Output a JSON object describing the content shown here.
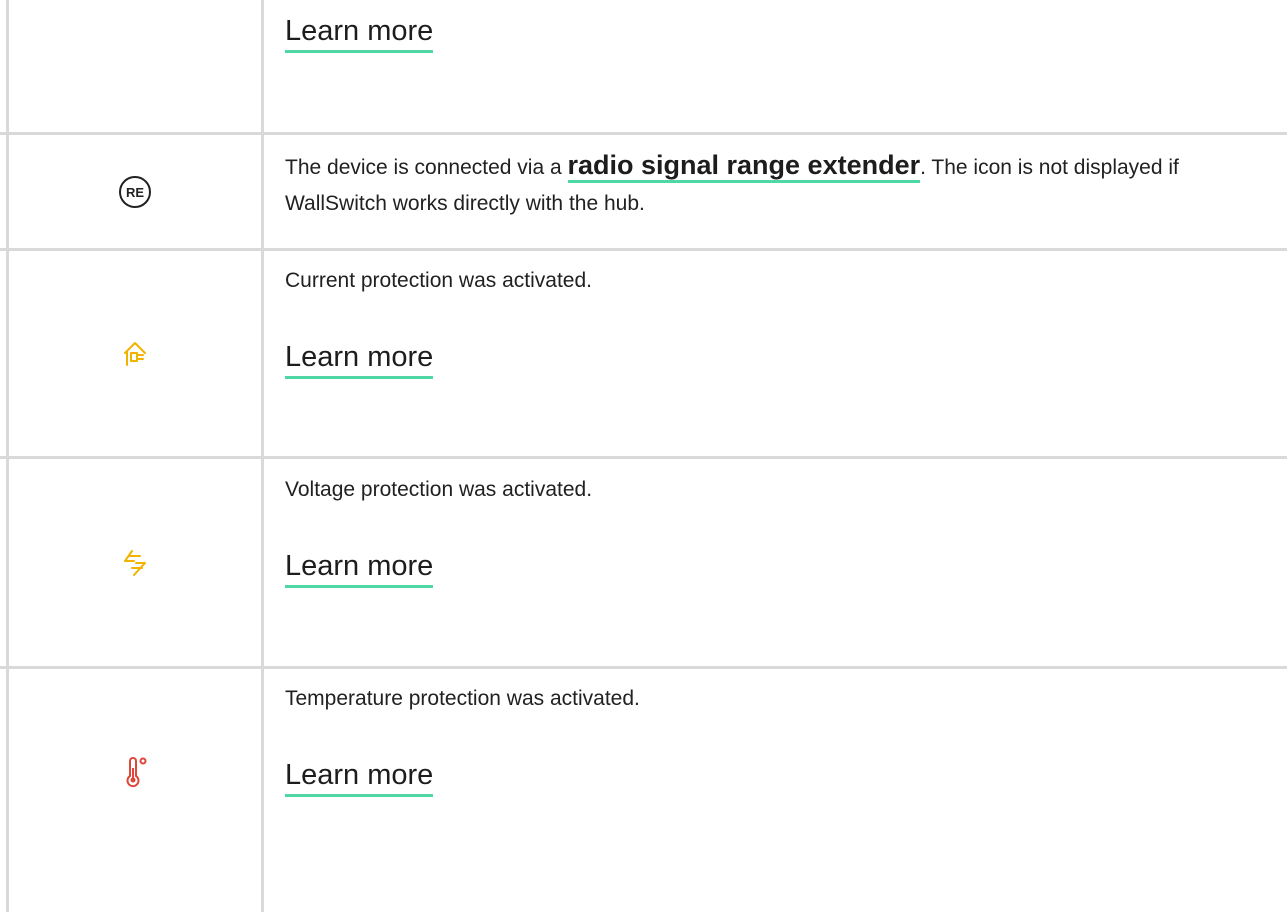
{
  "rows": [
    {
      "icon": "",
      "description": "",
      "link_label": "Learn more"
    },
    {
      "icon": "range-extender-icon",
      "description_before": "The device is connected via a ",
      "link_label": "radio signal range extender",
      "description_after": ". The icon is not displayed if WallSwitch works directly with the hub.",
      "icon_text": "RE"
    },
    {
      "icon": "current-protection-icon",
      "description": "Current protection was activated.",
      "link_label": "Learn more",
      "icon_color": "#f0b400"
    },
    {
      "icon": "voltage-protection-icon",
      "description": "Voltage protection was activated.",
      "link_label": "Learn more",
      "icon_color": "#f0b400"
    },
    {
      "icon": "temperature-protection-icon",
      "description": "Temperature protection was activated.",
      "link_label": "Learn more",
      "icon_color": "#e0463a"
    }
  ],
  "colors": {
    "link_underline": "#4fd8a4",
    "border": "#d9d9d9",
    "text": "#212121"
  }
}
